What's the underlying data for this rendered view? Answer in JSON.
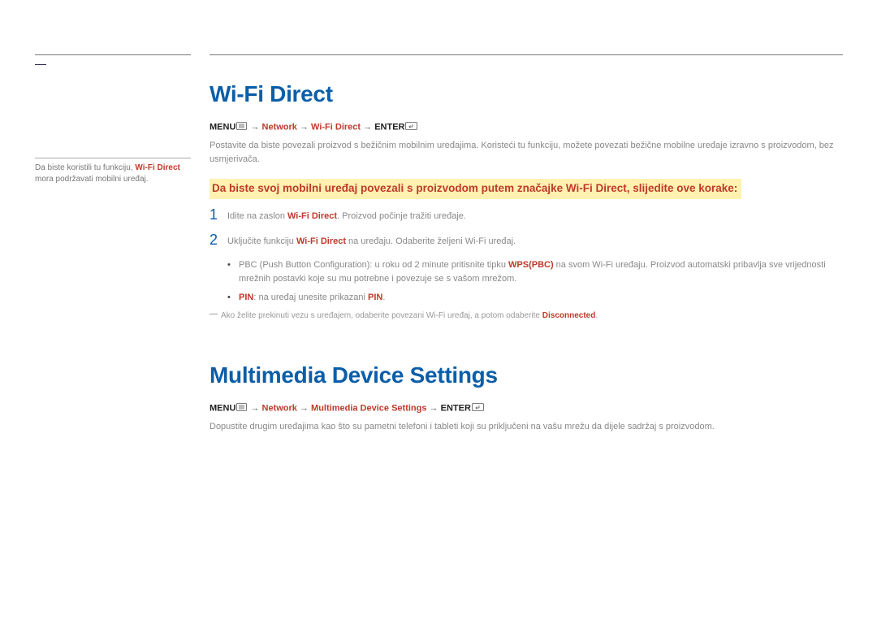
{
  "sidenote": {
    "prefix": "Da biste koristili tu funkciju, ",
    "hl": "Wi-Fi Direct",
    "suffix": " mora podržavati mobilni uređaj."
  },
  "section1": {
    "title": "Wi-Fi Direct",
    "menu_label": "MENU",
    "path_seg1": "Network",
    "path_seg2": "Wi-Fi Direct",
    "enter_label": "ENTER",
    "intro": "Postavite da biste povezali proizvod s bežičnim mobilnim uređajima. Koristeći tu funkciju, možete povezati bežične mobilne uređaje izravno s proizvodom, bez usmjerivača.",
    "subhead": "Da biste svoj mobilni uređaj povezali s proizvodom putem značajke Wi-Fi Direct, slijedite ove korake:",
    "step1": {
      "num": "1",
      "pre": "Idite na zaslon ",
      "hl": "Wi-Fi Direct",
      "post": ". Proizvod počinje tražiti uređaje."
    },
    "step2": {
      "num": "2",
      "pre": "Uključite funkciju ",
      "hl": "Wi-Fi Direct",
      "post": " na uređaju. Odaberite željeni Wi-Fi uređaj."
    },
    "bullet1": {
      "pre": "PBC (Push Button Configuration): u roku od 2 minute pritisnite tipku ",
      "hl": "WPS(PBC)",
      "post": " na svom Wi-Fi uređaju. Proizvod automatski pribavlja sve vrijednosti mrežnih postavki koje su mu potrebne i povezuje se s vašom mrežom."
    },
    "bullet2": {
      "hl1": "PIN",
      "mid": ": na uređaj unesite prikazani ",
      "hl2": "PIN",
      "post": "."
    },
    "footnote": {
      "pre": "Ako želite prekinuti vezu s uređajem, odaberite povezani Wi-Fi uređaj, a potom odaberite ",
      "hl": "Disconnected",
      "post": "."
    }
  },
  "section2": {
    "title": "Multimedia Device Settings",
    "menu_label": "MENU",
    "path_seg1": "Network",
    "path_seg2": "Multimedia Device Settings",
    "enter_label": "ENTER",
    "intro": "Dopustite drugim uređajima kao što su pametni telefoni i tableti koji su priključeni na vašu mrežu da dijele sadržaj s proizvodom."
  }
}
